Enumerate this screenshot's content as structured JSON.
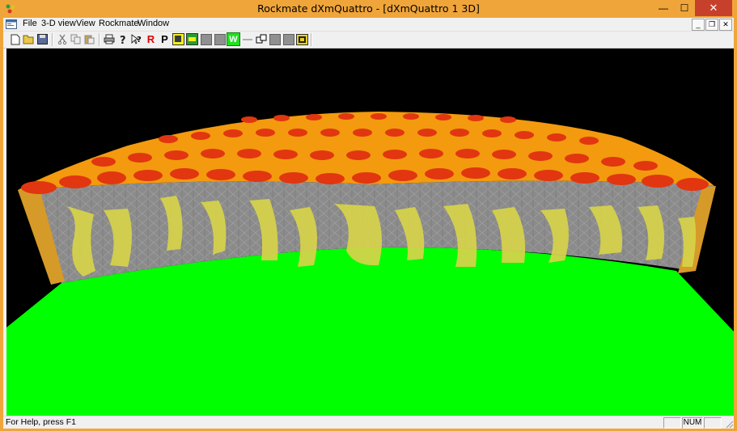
{
  "window": {
    "title": "Rockmate dXmQuattro - [dXmQuattro 1 3D]",
    "controls": {
      "minimize": "—",
      "maximize": "☐",
      "close": "✕"
    }
  },
  "menu": {
    "items": [
      "File",
      "3-D view",
      "View",
      "Rockmate",
      "Window"
    ],
    "mdi_controls": {
      "minimize": "_",
      "restore": "❐",
      "close": "✕"
    }
  },
  "toolbar": {
    "buttons": [
      {
        "name": "new-icon"
      },
      {
        "name": "open-icon"
      },
      {
        "name": "save-icon"
      },
      {
        "name": "cut-icon"
      },
      {
        "name": "copy-icon"
      },
      {
        "name": "paste-icon"
      },
      {
        "name": "print-icon"
      },
      {
        "name": "about-icon"
      },
      {
        "name": "context-help-icon"
      },
      {
        "name": "r-button",
        "label": "R"
      },
      {
        "name": "p-button",
        "label": "P"
      },
      {
        "name": "view-icon-1"
      },
      {
        "name": "view-icon-2"
      },
      {
        "name": "gray-button-1"
      },
      {
        "name": "gray-button-2"
      },
      {
        "name": "w-button",
        "label": "W"
      },
      {
        "name": "line-icon"
      },
      {
        "name": "windows-icon"
      },
      {
        "name": "gray-button-3"
      },
      {
        "name": "gray-button-4"
      },
      {
        "name": "gallery-icon"
      }
    ]
  },
  "status": {
    "help_text": "For Help, press F1",
    "num": "NUM"
  },
  "colors": {
    "title_bar": "#f0a53a",
    "close_button": "#c7402c",
    "background_3d": "#000000",
    "ground": "#00ff00",
    "rock_gray": "#8a8a8a",
    "rock_yellow": "#d7d34a",
    "top_red": "#e23a10",
    "top_orange": "#f6a200"
  }
}
